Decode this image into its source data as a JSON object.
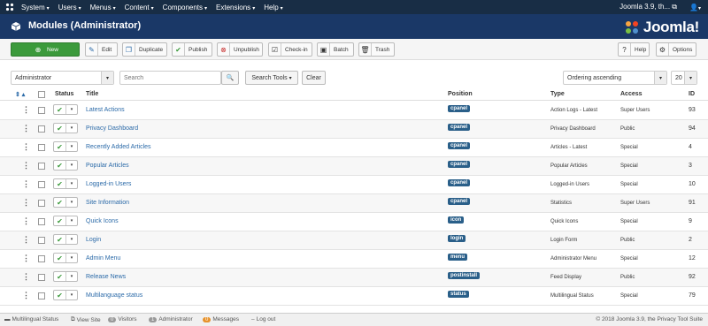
{
  "navbar": {
    "menu": [
      {
        "label": "System"
      },
      {
        "label": "Users"
      },
      {
        "label": "Menus"
      },
      {
        "label": "Content"
      },
      {
        "label": "Components"
      },
      {
        "label": "Extensions"
      },
      {
        "label": "Help"
      }
    ],
    "site_label": "Joomla 3.9, th..."
  },
  "header": {
    "title": "Modules (Administrator)",
    "brand": "Joomla!"
  },
  "toolbar": {
    "new_label": "New",
    "edit_label": "Edit",
    "duplicate_label": "Duplicate",
    "publish_label": "Publish",
    "unpublish_label": "Unpublish",
    "checkin_label": "Check-in",
    "batch_label": "Batch",
    "trash_label": "Trash",
    "help_label": "Help",
    "options_label": "Options"
  },
  "filters": {
    "client": "Administrator",
    "search_placeholder": "Search",
    "search_tools_label": "Search Tools",
    "clear_label": "Clear",
    "ordering": "Ordering ascending",
    "limit": "20"
  },
  "table": {
    "headers": {
      "status": "Status",
      "title": "Title",
      "position": "Position",
      "type": "Type",
      "access": "Access",
      "id": "ID"
    },
    "rows": [
      {
        "title": "Latest Actions",
        "position": "cpanel",
        "type": "Action Logs - Latest",
        "access": "Super Users",
        "id": "93"
      },
      {
        "title": "Privacy Dashboard",
        "position": "cpanel",
        "type": "Privacy Dashboard",
        "access": "Public",
        "id": "94"
      },
      {
        "title": "Recently Added Articles",
        "position": "cpanel",
        "type": "Articles - Latest",
        "access": "Special",
        "id": "4"
      },
      {
        "title": "Popular Articles",
        "position": "cpanel",
        "type": "Popular Articles",
        "access": "Special",
        "id": "3"
      },
      {
        "title": "Logged-in Users",
        "position": "cpanel",
        "type": "Logged-in Users",
        "access": "Special",
        "id": "10"
      },
      {
        "title": "Site Information",
        "position": "cpanel",
        "type": "Statistics",
        "access": "Super Users",
        "id": "91"
      },
      {
        "title": "Quick Icons",
        "position": "icon",
        "type": "Quick Icons",
        "access": "Special",
        "id": "9"
      },
      {
        "title": "Login",
        "position": "login",
        "type": "Login Form",
        "access": "Public",
        "id": "2"
      },
      {
        "title": "Admin Menu",
        "position": "menu",
        "type": "Administrator Menu",
        "access": "Special",
        "id": "12"
      },
      {
        "title": "Release News",
        "position": "postinstall",
        "type": "Feed Display",
        "access": "Public",
        "id": "92"
      },
      {
        "title": "Multilanguage status",
        "position": "status",
        "type": "Multilingual Status",
        "access": "Special",
        "id": "79"
      }
    ]
  },
  "statusbar": {
    "multilingual": "Multilingual Status",
    "view_site": "View Site",
    "visitors_count": "0",
    "visitors": "Visitors",
    "admin_count": "1",
    "admin": "Administrator",
    "messages_count": "0",
    "messages": "Messages",
    "logout": "Log out",
    "copyright": "© 2018 Joomla 3.9, the Privacy Tool Suite"
  }
}
